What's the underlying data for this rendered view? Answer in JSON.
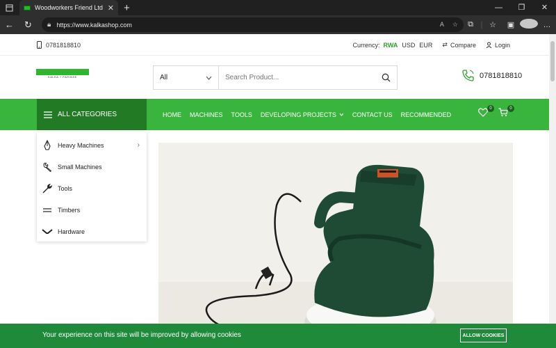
{
  "browser": {
    "tab_title": "Woodworkers Friend Ltd - Wood",
    "url": "https://www.kalkashop.com"
  },
  "topbar": {
    "phone": "0781818810",
    "currency_label": "Currency:",
    "currencies": [
      "RWA",
      "USD",
      "EUR"
    ],
    "compare": "Compare",
    "login": "Login"
  },
  "header": {
    "logo_text": "KALKA + FARINSE",
    "search_category": "All",
    "search_placeholder": "Search Product...",
    "phone": "0781818810"
  },
  "nav": {
    "all_categories": "ALL CATEGORIES",
    "items": [
      "HOME",
      "MACHINES",
      "TOOLS",
      "DEVELOPING PROJECTS",
      "CONTACT US",
      "RECOMMENDED"
    ],
    "wishlist_count": "0",
    "cart_count": "0"
  },
  "categories": [
    {
      "label": "Heavy Machines",
      "icon": "pen-nib-icon"
    },
    {
      "label": "Small Machines",
      "icon": "wrench-icon"
    },
    {
      "label": "Tools",
      "icon": "tool-icon"
    },
    {
      "label": "Timbers",
      "icon": "lines-icon"
    },
    {
      "label": "Hardware",
      "icon": "hinge-icon"
    }
  ],
  "cookie": {
    "text": "Your experience on this site will be improved by allowing cookies",
    "button": "ALLOW COOKIES"
  },
  "colors": {
    "brand_green": "#39b53e",
    "dark_green": "#227a25",
    "cookie_green": "#1f8a3a"
  }
}
